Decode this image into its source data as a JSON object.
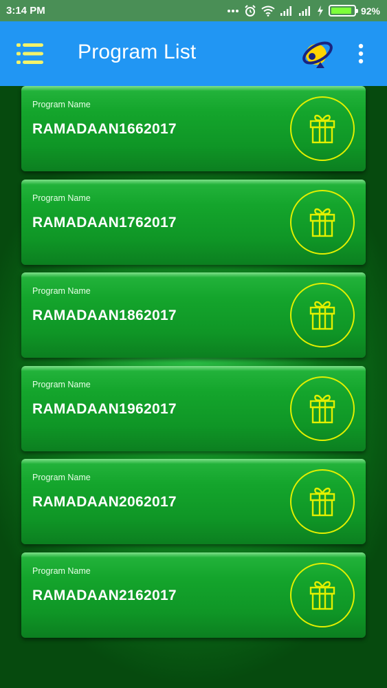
{
  "status_bar": {
    "time": "3:14 PM",
    "battery_text": "92%",
    "icons": [
      "dots-icon",
      "alarm-icon",
      "wifi-icon",
      "signal-icon",
      "signal-icon",
      "charging-icon",
      "battery-icon"
    ],
    "battery_level": 0.92
  },
  "app_bar": {
    "title": "Program List",
    "menu_icon": "list-menu-icon",
    "logo_icon": "app-logo",
    "overflow_icon": "more-vert-icon",
    "colors": {
      "background": "#2196f3",
      "menu_icon": "#f3f36a"
    }
  },
  "programs": [
    {
      "label": "Program Name",
      "name": "RAMADAAN1662017"
    },
    {
      "label": "Program Name",
      "name": "RAMADAAN1762017"
    },
    {
      "label": "Program Name",
      "name": "RAMADAAN1862017"
    },
    {
      "label": "Program Name",
      "name": "RAMADAAN1962017"
    },
    {
      "label": "Program Name",
      "name": "RAMADAAN2062017"
    },
    {
      "label": "Program Name",
      "name": "RAMADAAN2162017"
    }
  ],
  "card_icon": "gift-icon",
  "colors": {
    "card_green": "#14a52c",
    "gift_yellow": "#e3f000"
  }
}
